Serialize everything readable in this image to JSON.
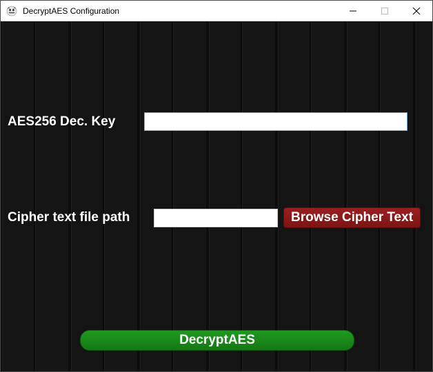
{
  "window": {
    "title": "DecryptAES Configuration"
  },
  "form": {
    "aes_key": {
      "label": "AES256 Dec. Key",
      "value": ""
    },
    "cipher_path": {
      "label": "Cipher text file path",
      "value": "",
      "browse_label": "Browse Cipher Text"
    },
    "submit_label": "DecryptAES"
  },
  "colors": {
    "browse_bg": "#8b1a1a",
    "submit_bg": "#1a8a1a"
  }
}
